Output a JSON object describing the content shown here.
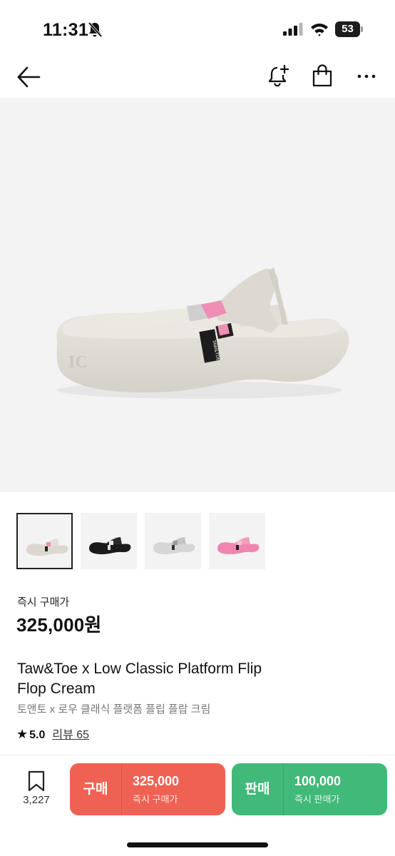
{
  "status_bar": {
    "time": "11:31",
    "battery": "53",
    "icons": [
      "bell-slash-icon",
      "signal-icon",
      "wifi-icon",
      "battery-icon"
    ]
  },
  "nav": {
    "icons": [
      "back-arrow-icon",
      "bell-plus-icon",
      "shopping-bag-icon",
      "more-icon"
    ]
  },
  "product": {
    "colors": [
      "Cream",
      "Black",
      "Silver",
      "Pink"
    ],
    "selected_color_index": 0,
    "price_label": "즉시 구매가",
    "price": "325,000원",
    "title_en_line1": "Taw&Toe x Low Classic Platform Flip",
    "title_en_line2": "Flop Cream",
    "title_ko": "토앤토 x 로우 클래식 플랫폼 플립 플랍 크림",
    "rating": "5.0",
    "reviews": "리뷰 65"
  },
  "bottom_bar": {
    "wish_count": "3,227",
    "buy": {
      "label": "구매",
      "price": "325,000",
      "sub": "즉시 구매가",
      "color": "#ef6253"
    },
    "sell": {
      "label": "판매",
      "price": "100,000",
      "sub": "즉시 판매가",
      "color": "#41b979"
    }
  }
}
